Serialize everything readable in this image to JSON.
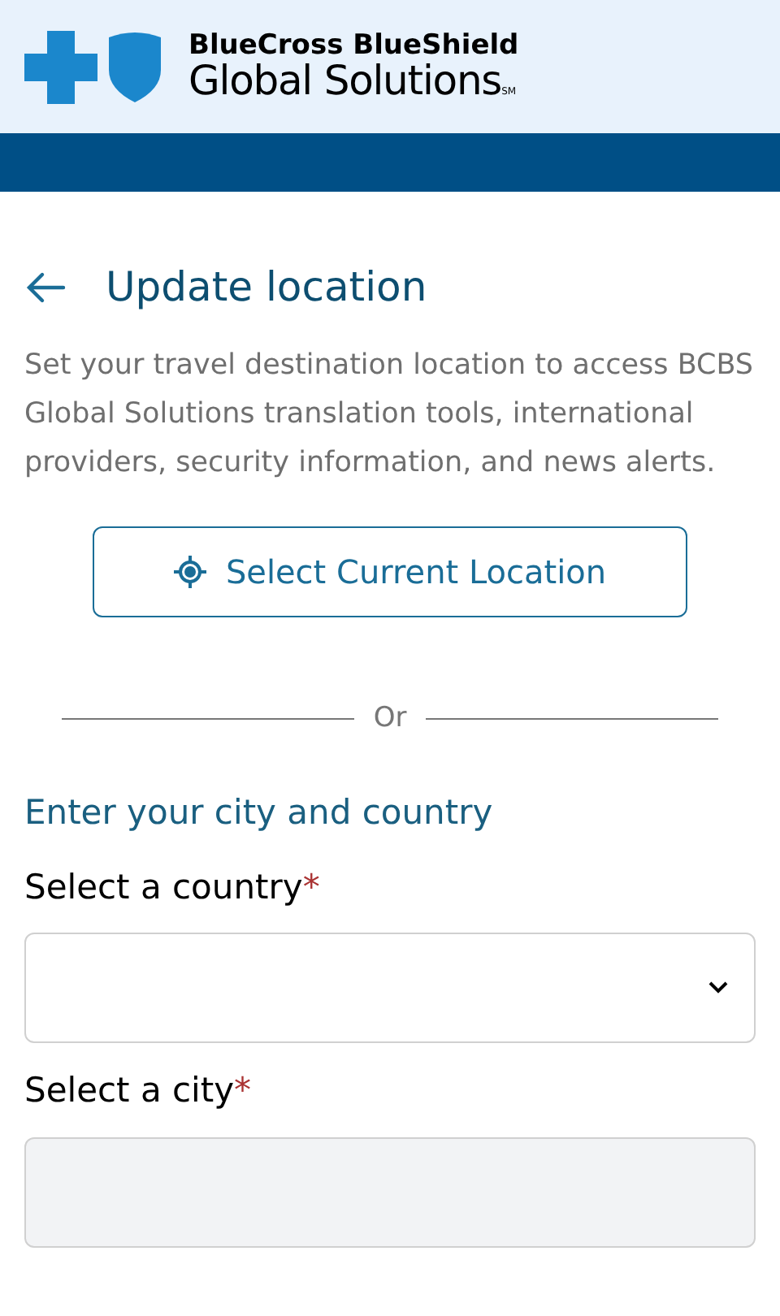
{
  "header": {
    "brand_line_1": "BlueCross BlueShield",
    "brand_line_2": "Global Solutions",
    "brand_mark": "SM"
  },
  "page": {
    "title": "Update location",
    "description": "Set your travel destination location to access BCBS Global Solutions translation tools, international providers, security information, and news alerts.",
    "location_button": "Select Current Location",
    "divider_text": "Or",
    "section_title": "Enter your city and country"
  },
  "fields": [
    {
      "label": "Select a country",
      "required_mark": "*",
      "kind": "select",
      "disabled": false
    },
    {
      "label": "Select a city",
      "required_mark": "*",
      "kind": "text",
      "disabled": true
    }
  ]
}
